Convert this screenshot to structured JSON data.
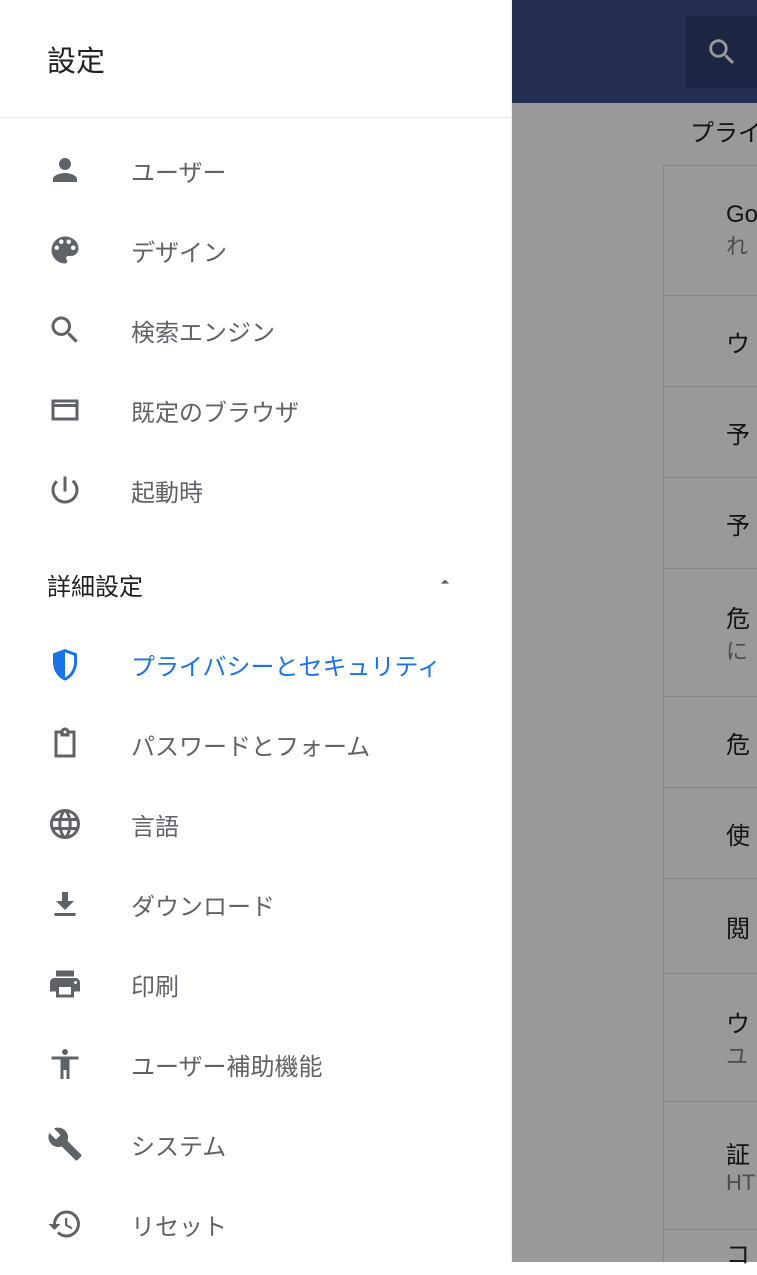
{
  "drawer": {
    "title": "設定",
    "items": [
      {
        "icon": "person",
        "label": "ユーザー"
      },
      {
        "icon": "palette",
        "label": "デザイン"
      },
      {
        "icon": "search",
        "label": "検索エンジン"
      },
      {
        "icon": "browser",
        "label": "既定のブラウザ"
      },
      {
        "icon": "power",
        "label": "起動時"
      }
    ],
    "advanced": {
      "title": "詳細設定",
      "expanded": true,
      "items": [
        {
          "icon": "shield",
          "label": "プライバシーとセキュリティ",
          "active": true
        },
        {
          "icon": "clipboard",
          "label": "パスワードとフォーム"
        },
        {
          "icon": "globe",
          "label": "言語"
        },
        {
          "icon": "download",
          "label": "ダウンロード"
        },
        {
          "icon": "print",
          "label": "印刷"
        },
        {
          "icon": "accessibility",
          "label": "ユーザー補助機能"
        },
        {
          "icon": "wrench",
          "label": "システム"
        },
        {
          "icon": "restore",
          "label": "リセット"
        }
      ]
    }
  },
  "background": {
    "section_label": "プライ",
    "rows": [
      {
        "text": "Go",
        "sub": "れ"
      },
      {
        "text": "ウ"
      },
      {
        "text": "予"
      },
      {
        "text": "予"
      },
      {
        "text": "危",
        "sub": "に"
      },
      {
        "text": "危"
      },
      {
        "text": "使"
      },
      {
        "text": "閲"
      },
      {
        "text": "ウ",
        "sub": "ユ"
      },
      {
        "text": "証",
        "sub": "HT"
      },
      {
        "text": "コ"
      }
    ]
  }
}
